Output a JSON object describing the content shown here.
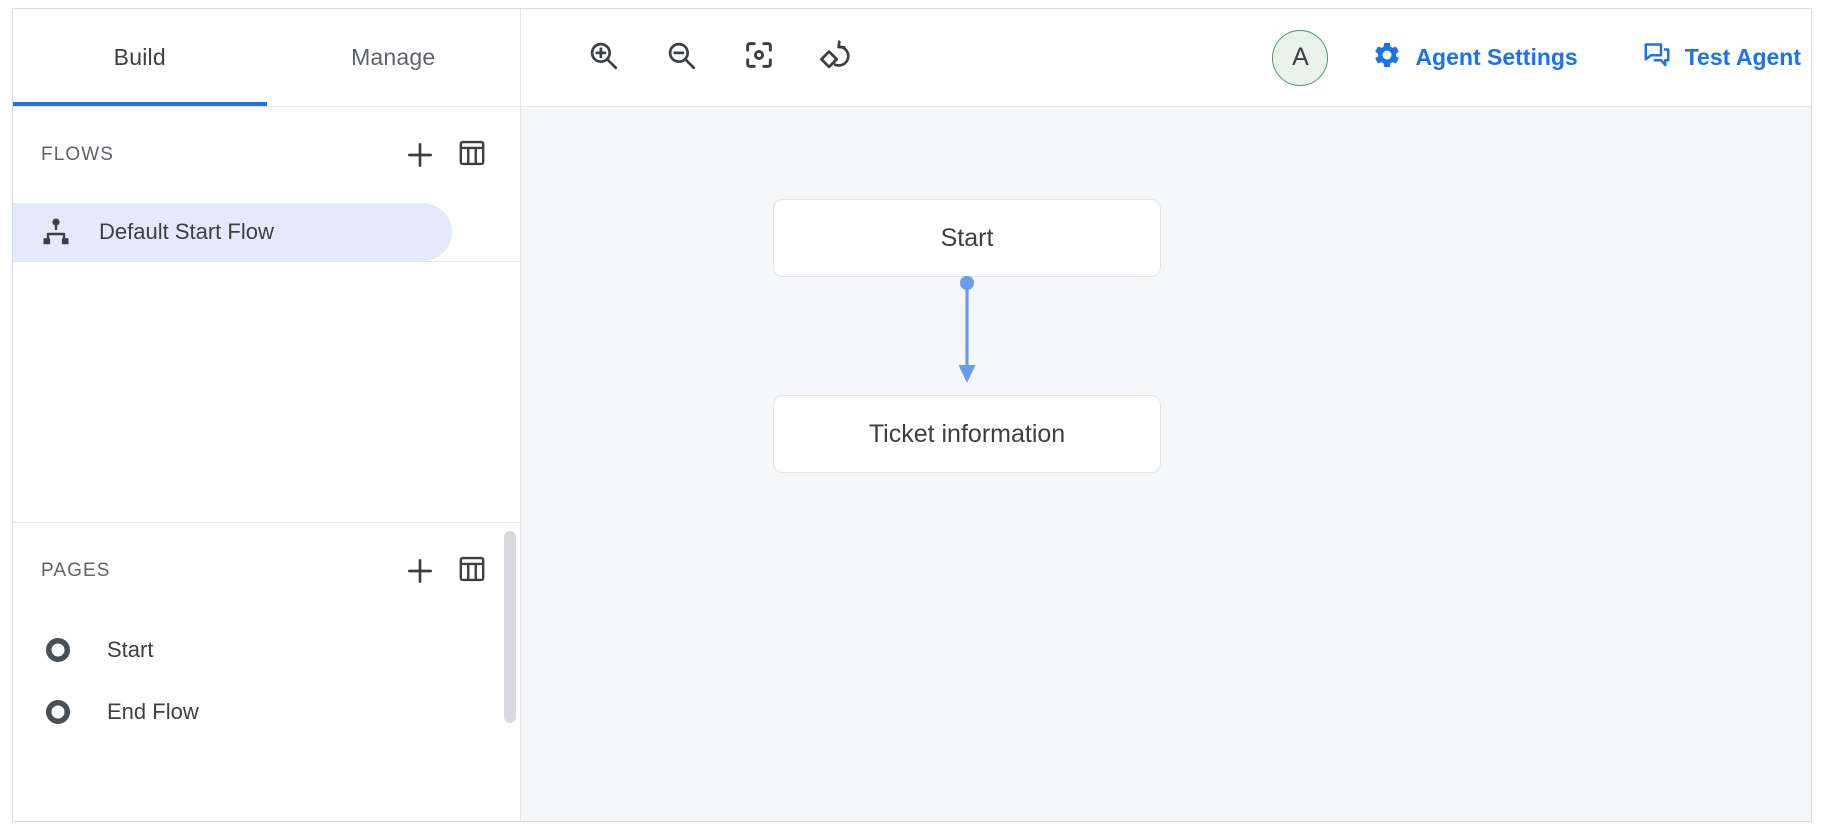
{
  "tabs": [
    {
      "label": "Build",
      "active": true
    },
    {
      "label": "Manage",
      "active": false
    }
  ],
  "toolbar": {
    "tools": [
      {
        "name": "zoom-in-icon",
        "label": "Zoom in"
      },
      {
        "name": "zoom-out-icon",
        "label": "Zoom out"
      },
      {
        "name": "center-focus-icon",
        "label": "Fit to screen"
      },
      {
        "name": "reset-layout-icon",
        "label": "Reset layout"
      }
    ],
    "avatar": {
      "initial": "A",
      "bg": "#e9f3ec",
      "border": "#4c9a6b"
    },
    "agent_settings_label": "Agent Settings",
    "test_agent_label": "Test Agent",
    "link_color": "#1a73e8"
  },
  "flows_panel": {
    "title": "FLOWS",
    "add_label": "+",
    "items": [
      {
        "label": "Default Start Flow",
        "selected": true
      }
    ]
  },
  "pages_panel": {
    "title": "PAGES",
    "add_label": "+",
    "items": [
      {
        "label": "Start"
      },
      {
        "label": "End Flow"
      }
    ]
  },
  "canvas": {
    "background": "#f6f7f9",
    "edge_color": "#6b9bf0",
    "nodes": [
      {
        "label": "Start"
      },
      {
        "label": "Ticket information"
      }
    ]
  }
}
